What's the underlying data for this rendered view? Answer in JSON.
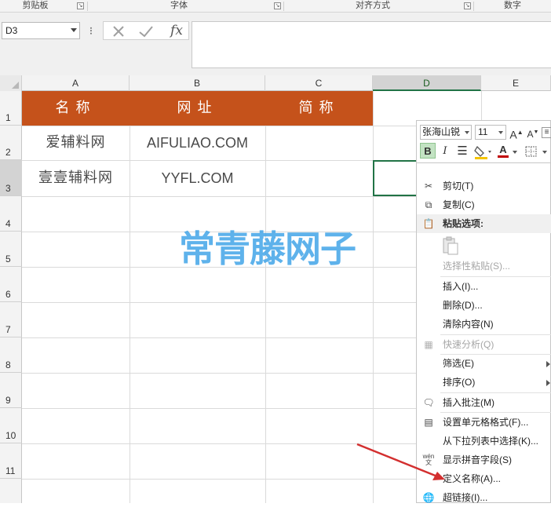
{
  "ribbon": {
    "groups": [
      "剪贴板",
      "字体",
      "对齐方式",
      "数字"
    ]
  },
  "formula_bar": {
    "name_box": "D3",
    "more_dots": "⁝",
    "fx_label": "fx",
    "content": ""
  },
  "columns": [
    "A",
    "B",
    "C",
    "D",
    "E"
  ],
  "rows": [
    "1",
    "2",
    "3",
    "4",
    "5",
    "6",
    "7",
    "8",
    "9",
    "10",
    "11"
  ],
  "active_cell": "D3",
  "table": {
    "headers": [
      "名称",
      "网址",
      "简称"
    ],
    "rows": [
      [
        "爱辅料网",
        "AIFULIAO.COM",
        ""
      ],
      [
        "壹壹辅料网",
        "YYFL.COM",
        ""
      ]
    ],
    "header_color": "#c5521b",
    "header_text_color": "#ffffff"
  },
  "watermark": "常青藤网子",
  "mini_toolbar": {
    "font_name": "张海山锐",
    "font_size": "11",
    "grow_font": "A",
    "shrink_font": "A",
    "bold": "B",
    "italic": "I",
    "font_color_letter": "A",
    "highlight_color": "#f5c400",
    "font_color": "#c00000"
  },
  "context_menu": {
    "items": [
      {
        "label": "剪切(T)",
        "icon": "scissors-icon"
      },
      {
        "label": "复制(C)",
        "icon": "copy-icon"
      },
      {
        "label": "粘贴选项:",
        "icon": "paste-icon"
      },
      {
        "label": "选择性粘贴(S)...",
        "icon": ""
      },
      {
        "label": "插入(I)...",
        "icon": ""
      },
      {
        "label": "删除(D)...",
        "icon": ""
      },
      {
        "label": "清除内容(N)",
        "icon": ""
      },
      {
        "label": "快速分析(Q)",
        "icon": "quick-analysis-icon"
      },
      {
        "label": "筛选(E)",
        "icon": ""
      },
      {
        "label": "排序(O)",
        "icon": ""
      },
      {
        "label": "插入批注(M)",
        "icon": "comment-icon"
      },
      {
        "label": "设置单元格格式(F)...",
        "icon": "format-cells-icon"
      },
      {
        "label": "从下拉列表中选择(K)...",
        "icon": ""
      },
      {
        "label": "显示拼音字段(S)",
        "icon": "phonetic-icon"
      },
      {
        "label": "定义名称(A)...",
        "icon": ""
      },
      {
        "label": "超链接(I)...",
        "icon": "hyperlink-icon"
      }
    ],
    "phonetic_icon_text": "wén"
  },
  "annotation_arrow_color": "#d32f2f"
}
